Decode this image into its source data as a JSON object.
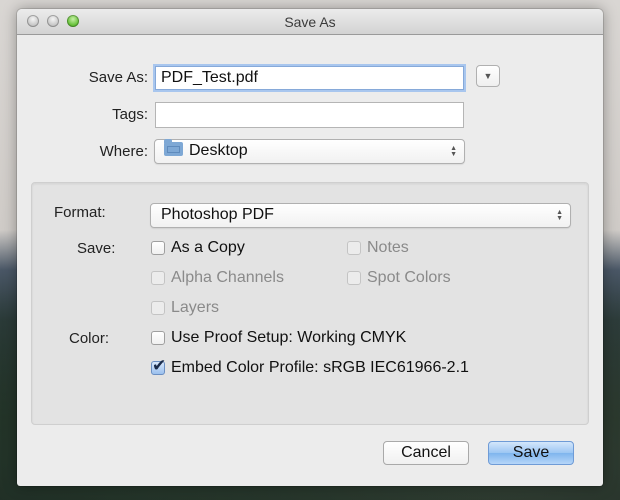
{
  "window": {
    "title": "Save As",
    "traffic_lights": [
      "close",
      "minimize",
      "zoom"
    ]
  },
  "save_as": {
    "label": "Save As:",
    "value": "PDF_Test.pdf"
  },
  "tags": {
    "label": "Tags:",
    "value": ""
  },
  "where": {
    "label": "Where:",
    "icon": "folder-icon",
    "value": "Desktop"
  },
  "disclosure": {
    "icon": "triangle-down-icon",
    "glyph": "▼"
  },
  "options": {
    "format": {
      "label": "Format:",
      "value": "Photoshop PDF"
    },
    "save": {
      "label": "Save:",
      "checkboxes": [
        {
          "label": "As a Copy",
          "checked": false,
          "enabled": true
        },
        {
          "label": "Notes",
          "checked": false,
          "enabled": false
        },
        {
          "label": "Alpha Channels",
          "checked": false,
          "enabled": false
        },
        {
          "label": "Spot Colors",
          "checked": false,
          "enabled": false
        },
        {
          "label": "Layers",
          "checked": false,
          "enabled": false
        }
      ]
    },
    "color": {
      "label": "Color:",
      "checkboxes": [
        {
          "label": "Use Proof Setup:  Working CMYK",
          "checked": false,
          "enabled": true
        },
        {
          "label": "Embed Color Profile:  sRGB IEC61966-2.1",
          "checked": true,
          "enabled": true
        }
      ]
    }
  },
  "buttons": {
    "cancel": "Cancel",
    "save": "Save"
  },
  "glyphs": {
    "check": "✔",
    "stepper_up": "▲",
    "stepper_down": "▼"
  },
  "colors": {
    "focus_ring": "#a8c6ee",
    "default_button": "#9cc6f3",
    "zoom_light": "#67c23a"
  }
}
